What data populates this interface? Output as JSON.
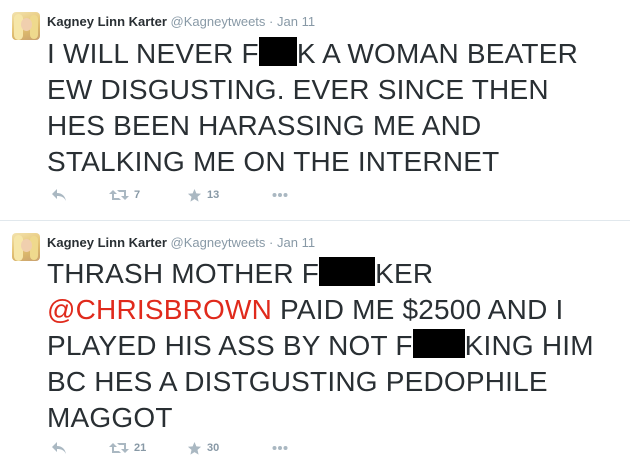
{
  "tweets": [
    {
      "author_name": "Kagney Linn Karter",
      "handle": "@Kagneytweets",
      "separator": "·",
      "time": "Jan 11",
      "text_line1_a": "I WILL NEVER F",
      "text_line1_b": "K A WOMAN BEATER",
      "text_line2": "EW DISGUSTING. EVER SINCE THEN",
      "text_line3": "HES BEEN HARASSING ME AND",
      "text_line4": "STALKING ME ON THE INTERNET",
      "retweets": "7",
      "favorites": "13"
    },
    {
      "author_name": "Kagney Linn Karter",
      "handle": "@Kagneytweets",
      "separator": "·",
      "time": "Jan 11",
      "text_line1_a": "THRASH MOTHER F",
      "text_line1_b": "KER",
      "mention": "@CHRISBROWN",
      "text_line2_rest": " PAID ME $2500 AND I",
      "text_line3_a": "PLAYED HIS ASS BY NOT F",
      "text_line3_b": "KING HIM",
      "text_line4": "BC HES A DISTGUSTING PEDOPHILE",
      "text_line5": "MAGGOT",
      "retweets": "21",
      "favorites": "30"
    }
  ],
  "icons": {
    "reply": "reply-icon",
    "retweet": "retweet-icon",
    "favorite": "star-icon",
    "more": "more-dots-icon"
  },
  "colors": {
    "text": "#292f33",
    "muted": "#8899a6",
    "mention": "#e02a1c",
    "divider": "#e1e8ed",
    "redaction": "#000000"
  }
}
